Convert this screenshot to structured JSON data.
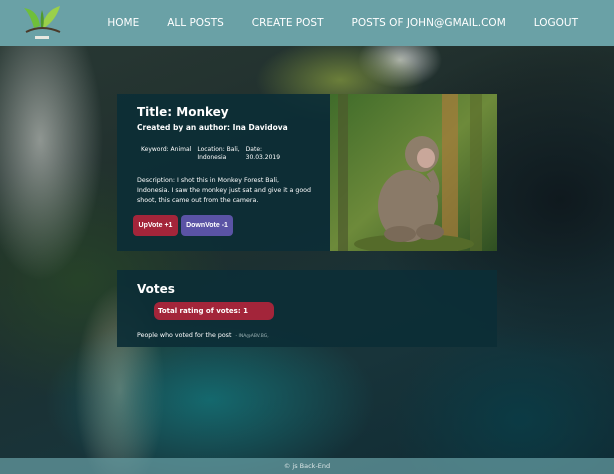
{
  "nav": {
    "links": [
      "HOME",
      "ALL POSTS",
      "CREATE POST",
      "POSTS OF JOHN@GMAIL.COM",
      "LOGOUT"
    ],
    "color": "#6aa1a6"
  },
  "post": {
    "title": "Title: Monkey",
    "author": "Created by an author: Ina Davidova",
    "keyword_label": "Keyword: Animal",
    "location_label": "Location: Bali,",
    "location_line2": "Indonesia",
    "date_label": "Date:",
    "date_value": "30.03.2019",
    "description": "Description: I shot this in Monkey Forest Bali, Indonesia. I saw the monkey just sat and give it a good shoot, this came out from the camera.",
    "upvote_label": "UpVote +1",
    "downvote_label": "DownVote -1"
  },
  "votes": {
    "heading": "Votes",
    "total": "Total rating of votes: 1",
    "voters_text": "People who voted for the post",
    "voters_list": "- INA@ABV.BG,"
  },
  "footer": {
    "text": "© js Back-End"
  },
  "colors": {
    "accent_red": "#a3253a",
    "accent_purple": "#5a53a5",
    "panel": "#0c2e36"
  }
}
